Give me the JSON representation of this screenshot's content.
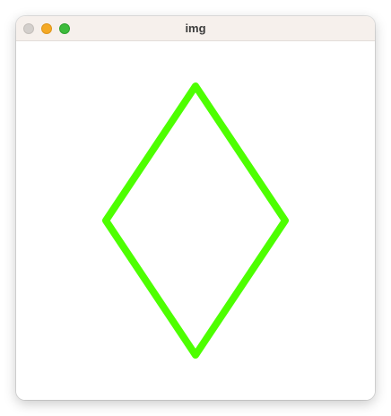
{
  "window": {
    "title": "img"
  },
  "controls": {
    "close_icon": "close-icon",
    "minimize_icon": "minimize-icon",
    "zoom_icon": "zoom-icon"
  },
  "colors": {
    "diamond_stroke": "#4dff00",
    "close": "#d3cfcc",
    "minimize": "#f4a925",
    "zoom": "#3dbb3c",
    "titlebar": "#f6f0ec"
  }
}
